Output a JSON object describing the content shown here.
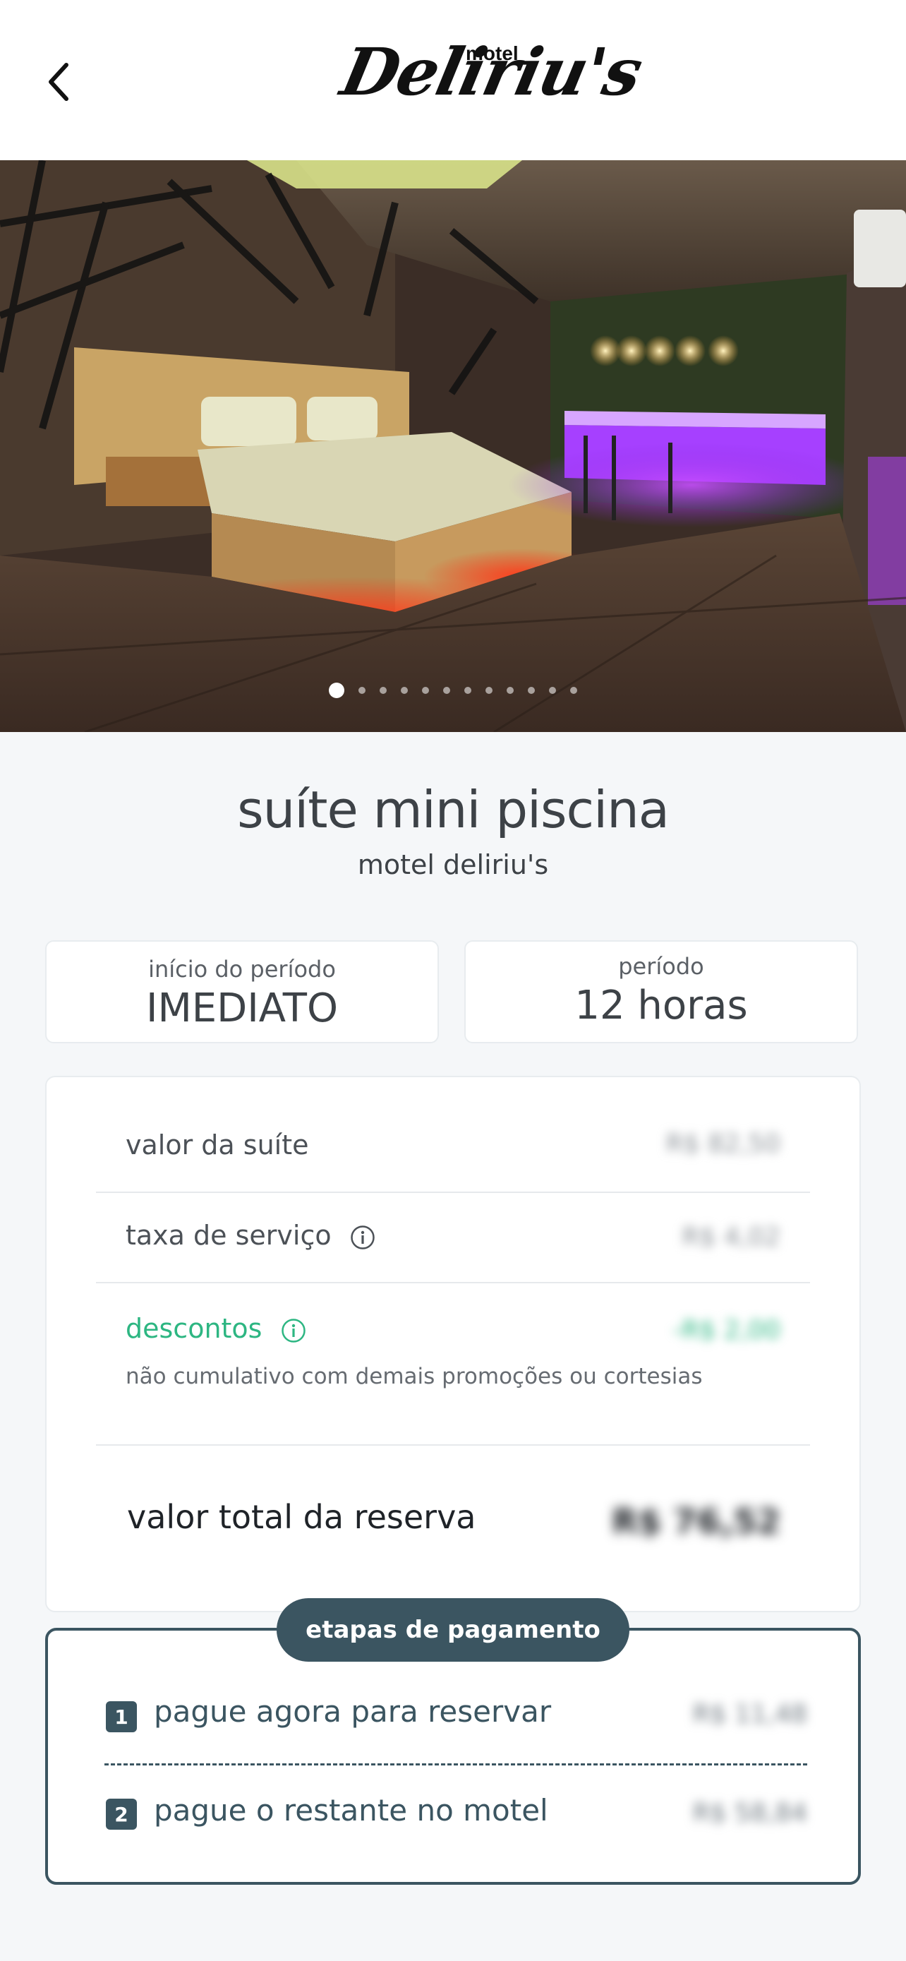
{
  "header": {
    "logo_small": "motel",
    "logo_script": "Deliriu's"
  },
  "hero": {
    "image_count": 12,
    "active_index": 0
  },
  "suite": {
    "title": "suíte mini piscina",
    "motel": "motel deliriu's"
  },
  "info": {
    "start_label": "início do período",
    "start_value": "IMEDIATO",
    "period_label": "período",
    "period_value": "12 horas"
  },
  "pricing": {
    "suite_label": "valor da suíte",
    "suite_value": "R$ 82,50",
    "fee_label": "taxa de serviço",
    "fee_value": "R$ 4,02",
    "discount_label": "descontos",
    "discount_value": "-R$ 2,00",
    "discount_note": "não cumulativo com demais promoções ou cortesias",
    "total_label": "valor total da reserva",
    "total_value": "R$ 76,52"
  },
  "payment": {
    "title": "etapas de pagamento",
    "step1_num": "1",
    "step1_label": "pague agora para reservar",
    "step1_value": "R$ 11,48",
    "step2_num": "2",
    "step2_label": "pague o restante no motel",
    "step2_value": "R$ 58,84"
  },
  "colors": {
    "accent": "#3b5561",
    "discount": "#2db682",
    "background": "#f5f7f9"
  }
}
